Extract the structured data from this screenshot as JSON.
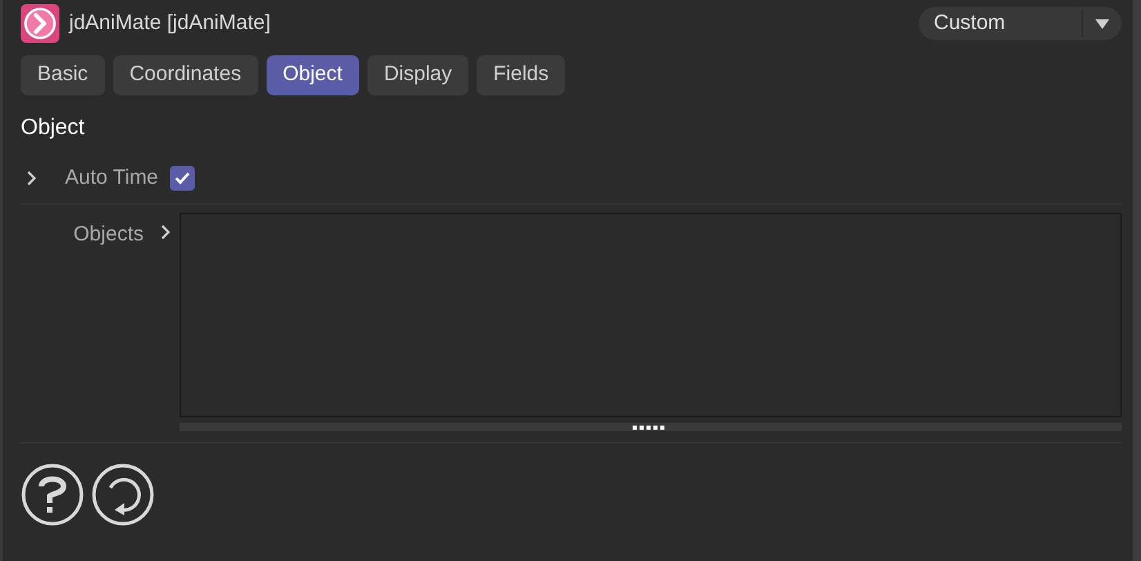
{
  "window": {
    "title": "jdAniMate [jdAniMate]"
  },
  "preset": {
    "value": "Custom"
  },
  "tabs": [
    {
      "label": "Basic",
      "selected": false
    },
    {
      "label": "Coordinates",
      "selected": false
    },
    {
      "label": "Object",
      "selected": true
    },
    {
      "label": "Display",
      "selected": false
    },
    {
      "label": "Fields",
      "selected": false
    }
  ],
  "section": {
    "title": "Object"
  },
  "auto_time": {
    "label": "Auto Time",
    "checked": true
  },
  "objects": {
    "label": "Objects"
  }
}
